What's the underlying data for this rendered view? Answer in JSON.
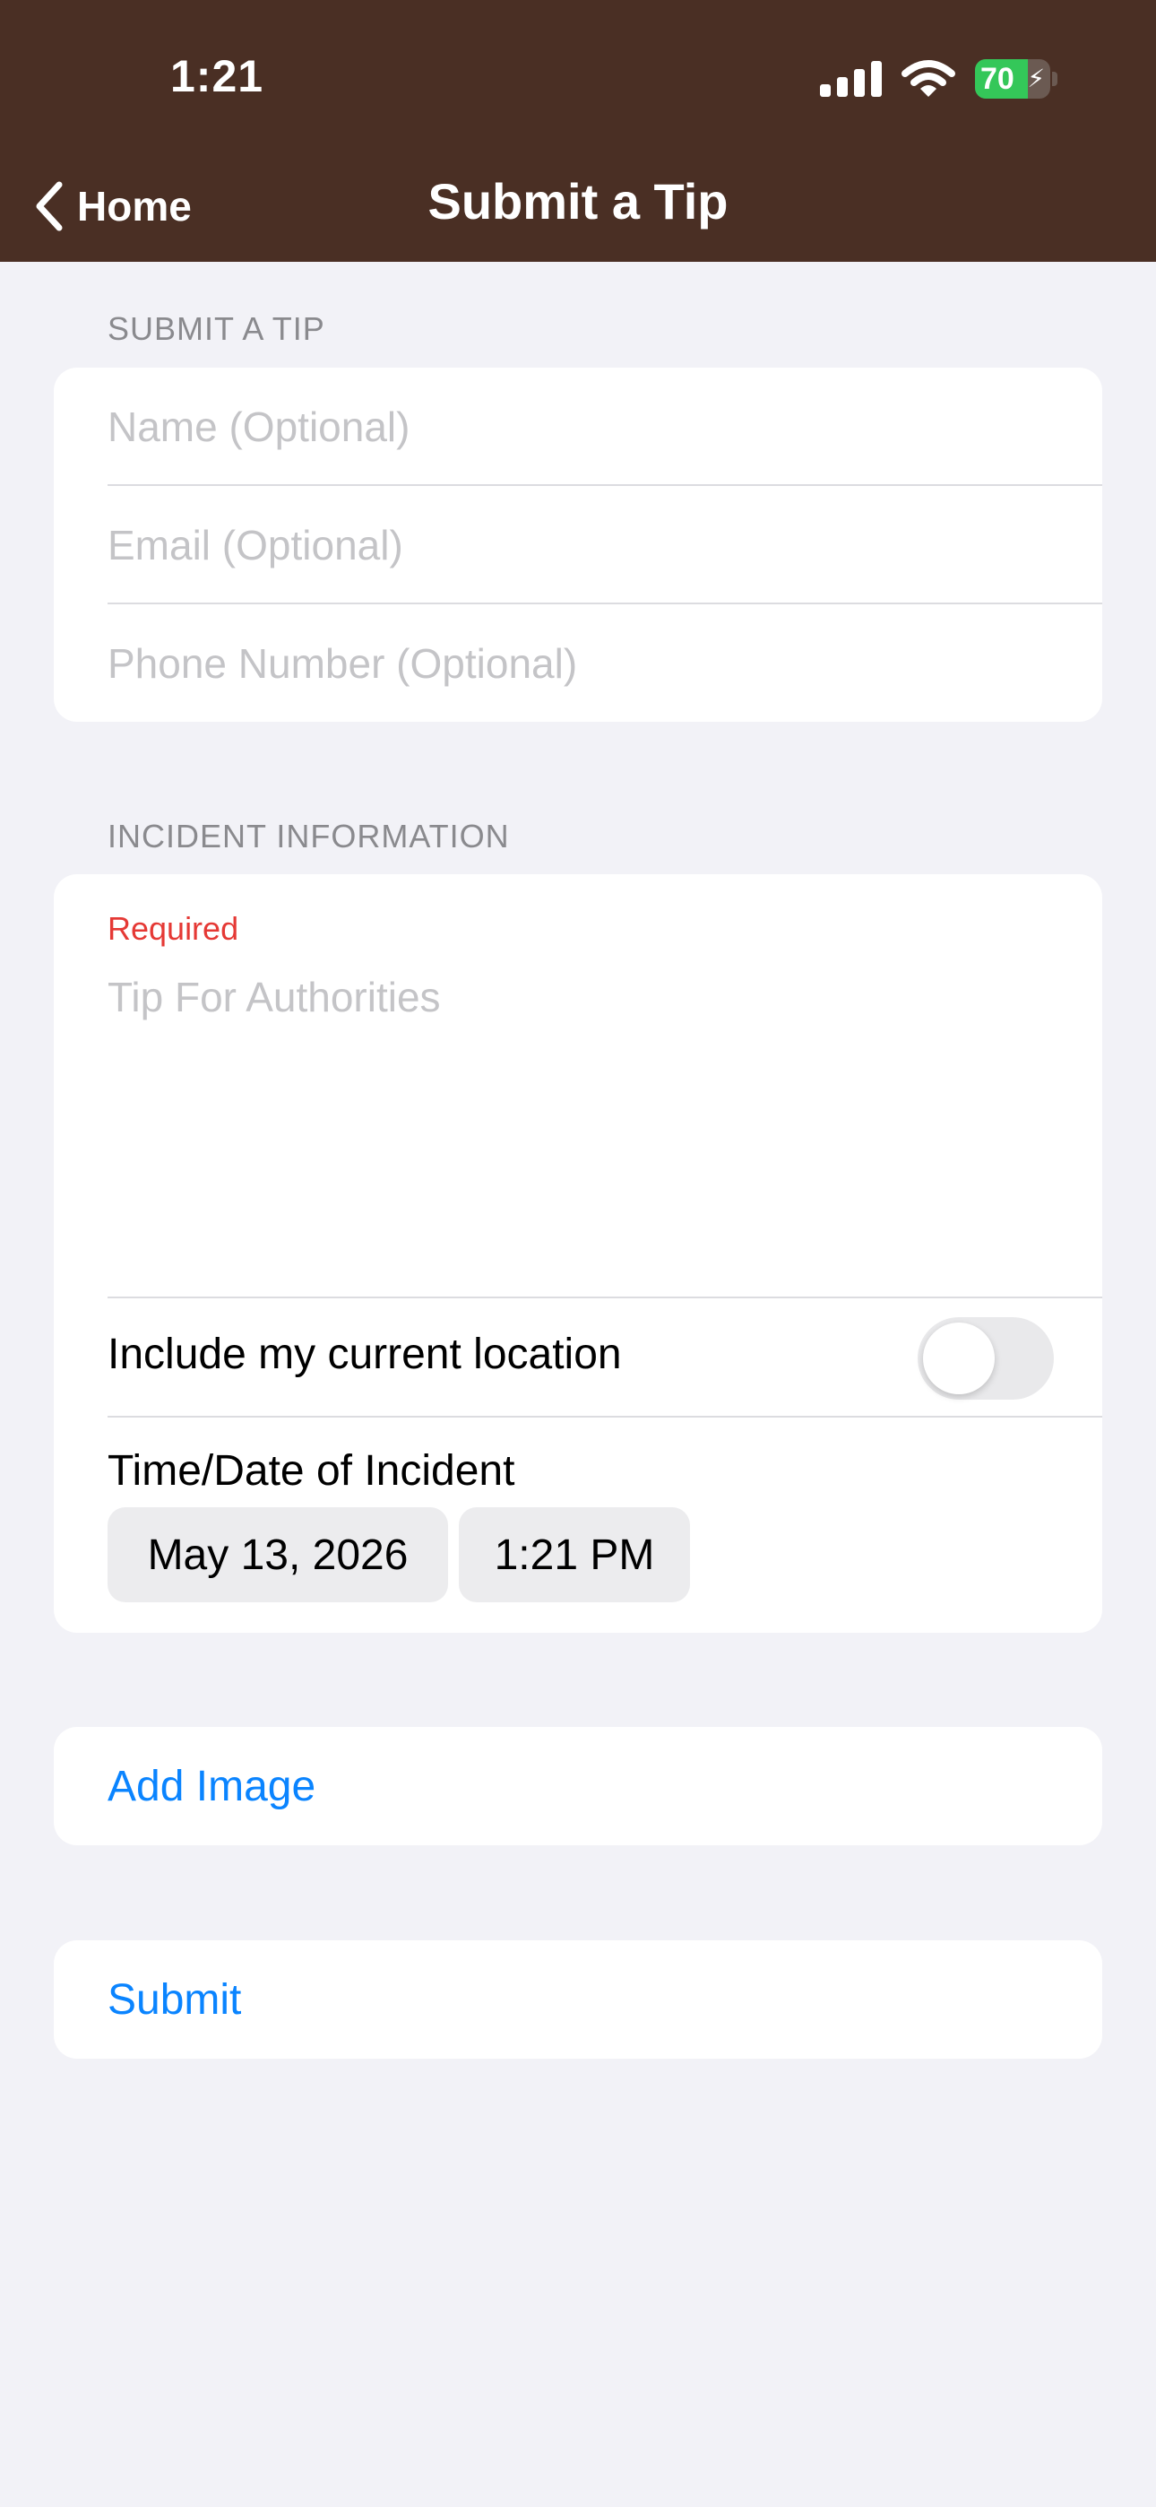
{
  "status_bar": {
    "time": "1:21",
    "battery_level": "70"
  },
  "nav": {
    "back_label": "Home",
    "title": "Submit a Tip"
  },
  "contact_section": {
    "header": "SUBMIT A TIP",
    "name_placeholder": "Name (Optional)",
    "email_placeholder": "Email (Optional)",
    "phone_placeholder": "Phone Number (Optional)"
  },
  "incident_section": {
    "header": "INCIDENT INFORMATION",
    "required_label": "Required",
    "tip_placeholder": "Tip For Authorities",
    "location_label": "Include my current location",
    "location_enabled": false,
    "datetime_label": "Time/Date of Incident",
    "date_value": "May 13, 2026",
    "time_value": "1:21 PM"
  },
  "actions": {
    "add_image_label": "Add Image",
    "submit_label": "Submit"
  },
  "colors": {
    "nav_background": "#4a2f24",
    "page_background": "#f2f2f7",
    "accent": "#0a84ff",
    "required": "#e53935",
    "battery": "#34c759"
  }
}
